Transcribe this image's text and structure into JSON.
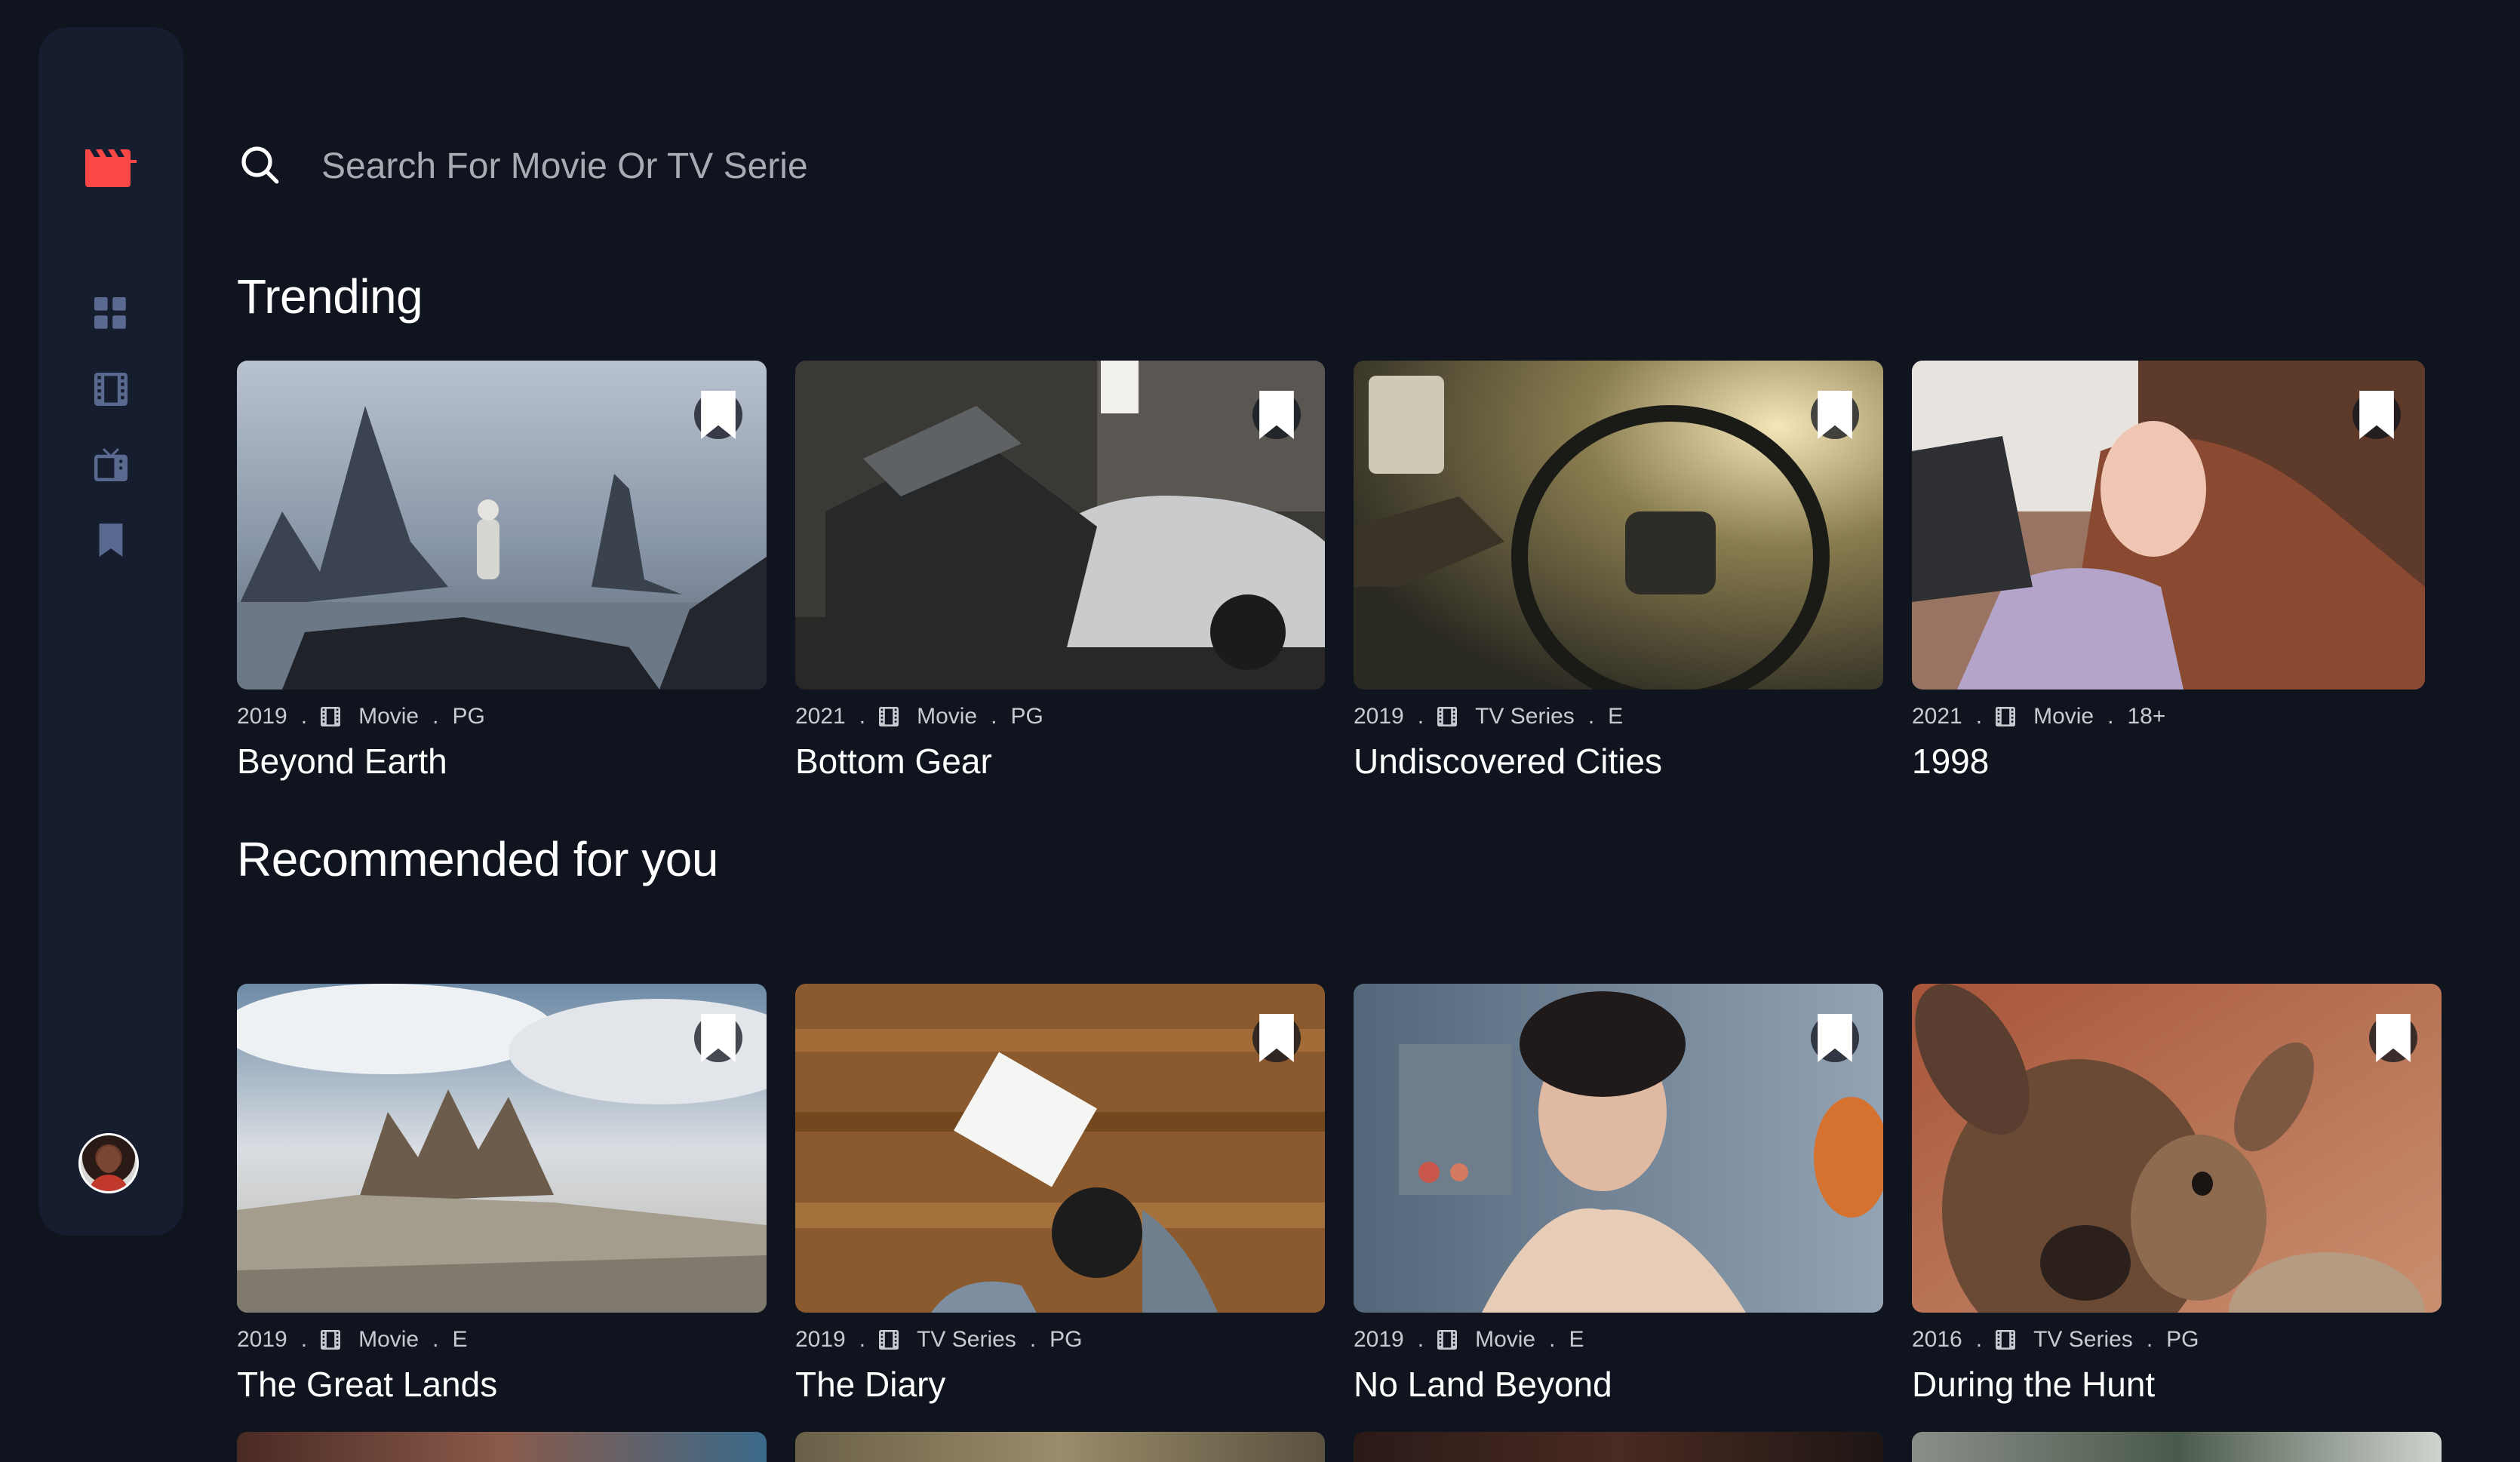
{
  "search": {
    "placeholder": "Search For Movie Or TV Serie"
  },
  "nav": {
    "logo": "movie-clapper-icon",
    "items": [
      {
        "icon": "home-grid-icon",
        "active": false
      },
      {
        "icon": "movies-film-icon",
        "active": false
      },
      {
        "icon": "tv-series-icon",
        "active": false
      },
      {
        "icon": "bookmark-icon",
        "active": false
      }
    ]
  },
  "colors": {
    "background": "#10141e",
    "sidebar": "#161d2f",
    "accent": "#fc4747",
    "nav_icon": "#5a698f"
  },
  "trending": {
    "title": "Trending",
    "items": [
      {
        "year": "2019",
        "category": "Movie",
        "rating": "PG",
        "title": "Beyond Earth"
      },
      {
        "year": "2021",
        "category": "Movie",
        "rating": "PG",
        "title": "Bottom Gear"
      },
      {
        "year": "2019",
        "category": "TV Series",
        "rating": "E",
        "title": "Undiscovered Cities"
      },
      {
        "year": "2021",
        "category": "Movie",
        "rating": "18+",
        "title": "1998"
      }
    ]
  },
  "recommended": {
    "title": "Recommended for you",
    "items": [
      {
        "year": "2019",
        "category": "Movie",
        "rating": "E",
        "title": "The Great Lands"
      },
      {
        "year": "2019",
        "category": "TV Series",
        "rating": "PG",
        "title": "The Diary"
      },
      {
        "year": "2019",
        "category": "Movie",
        "rating": "E",
        "title": "No Land Beyond"
      },
      {
        "year": "2016",
        "category": "TV Series",
        "rating": "PG",
        "title": "During the Hunt"
      }
    ]
  },
  "dot": "."
}
